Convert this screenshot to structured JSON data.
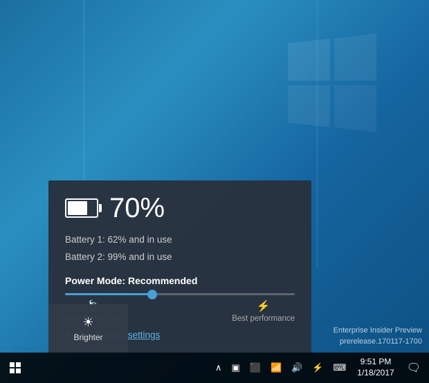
{
  "desktop": {
    "background_color": "#1a6fa0"
  },
  "battery_panel": {
    "percent": "70%",
    "battery1": "Battery 1: 62% and in use",
    "battery2": "Battery 2: 99% and in use",
    "power_mode_label": "Power Mode: Recommended",
    "slider_fill_percent": 38,
    "label_left_icon": "🍃",
    "label_left_text": "Best battery life",
    "label_right_icon": "⚡",
    "label_right_text": "Best performance",
    "power_link": "Power & sleep settings"
  },
  "brightness_tile": {
    "icon": "☀",
    "label": "Brighter"
  },
  "taskbar": {
    "chevron": "∧",
    "tray_icons": [
      "▣",
      "⬛",
      "📶",
      "🔊",
      "⚡",
      "⌨"
    ],
    "time": "9:51 PM",
    "date": "1/18/2017",
    "notification_icon": "🗨"
  },
  "enterprise_text": {
    "line1": "Enterprise Insider Preview",
    "line2": "prerelease.170117-1700"
  }
}
